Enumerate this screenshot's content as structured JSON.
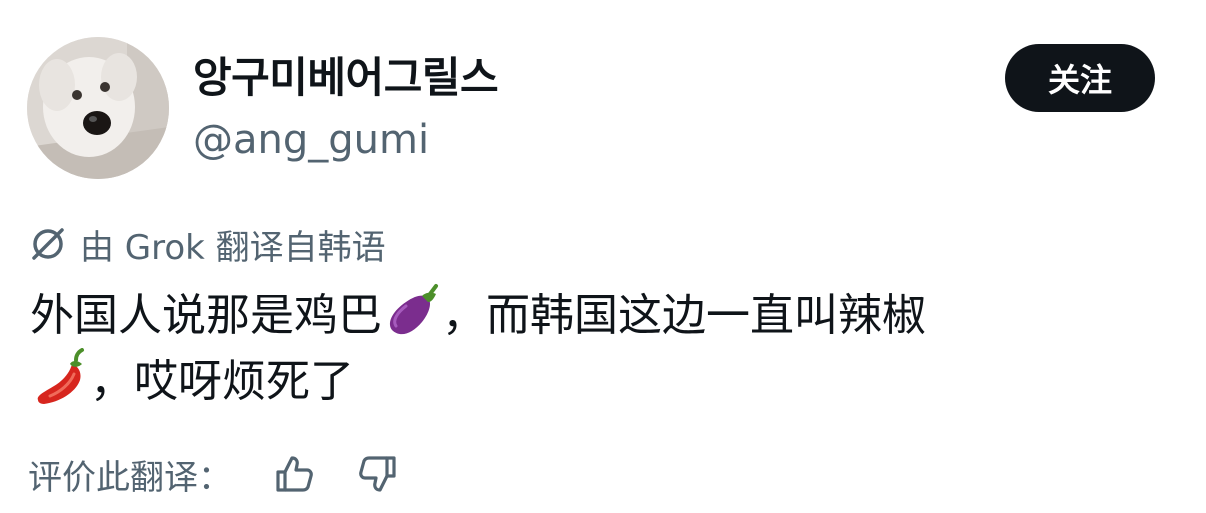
{
  "author": {
    "display_name": "앙구미베어그릴스",
    "handle": "@ang_gumi",
    "avatar_icon": "dog-avatar"
  },
  "follow_button": {
    "label": "关注"
  },
  "translation": {
    "note": "由 Grok 翻译自韩语",
    "icon": "grok-icon"
  },
  "tweet": {
    "line1_a": "外国人说那是鸡巴",
    "line1_emoji": "eggplant-emoji",
    "line1_b": "，而韩国这边一直叫辣椒",
    "line2_emoji": "hot-pepper-emoji",
    "line2_b": "，哎呀烦死了"
  },
  "rating": {
    "label": "评价此翻译：",
    "up_icon": "thumbs-up-icon",
    "down_icon": "thumbs-down-icon"
  },
  "colors": {
    "text_primary": "#0f1419",
    "text_secondary": "#536471",
    "button_bg": "#0f1419",
    "button_text": "#ffffff"
  }
}
